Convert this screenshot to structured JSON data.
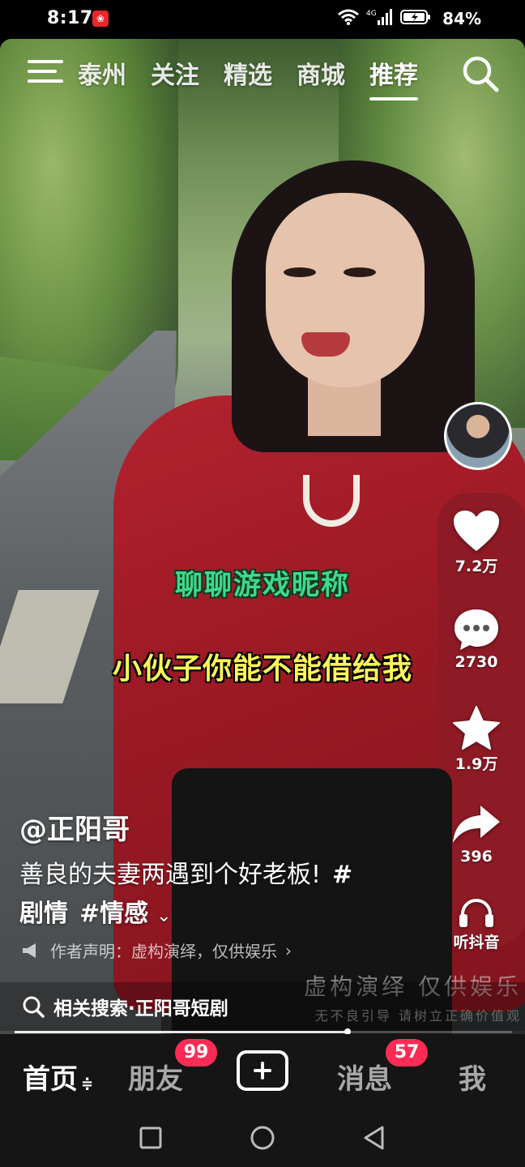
{
  "status_bar": {
    "time": "8:17",
    "network": "4G",
    "battery_pct": "84%"
  },
  "top_nav": {
    "tabs": [
      {
        "label": "泰州",
        "active": false
      },
      {
        "label": "关注",
        "active": false
      },
      {
        "label": "精选",
        "active": false
      },
      {
        "label": "商城",
        "active": false
      },
      {
        "label": "推荐",
        "active": true
      }
    ],
    "menu_icon": "hamburger-icon",
    "search_icon": "search-icon"
  },
  "video": {
    "subtitle_top": "聊聊游戏昵称",
    "subtitle_main": "小伙子你能不能借给我",
    "author": "@正阳哥",
    "description": "善良的夫妻两遇到个好老板!",
    "tags": [
      "#剧情",
      "#情感"
    ],
    "disclaimer": "作者声明：虚构演绎，仅供娱乐",
    "watermark_line1": "虚构演绎  仅供娱乐",
    "watermark_line2": "无不良引导  请树立正确价值观",
    "progress": 0.67
  },
  "actions": {
    "likes": "7.2万",
    "comments": "2730",
    "favorites": "1.9万",
    "shares": "396",
    "listen_label": "听抖音"
  },
  "related_search": {
    "label": "相关搜索·正阳哥短剧"
  },
  "tab_bar": {
    "home": "首页",
    "home_swap": "≑",
    "friends": "朋友",
    "friends_badge": "99",
    "messages": "消息",
    "messages_badge": "57",
    "me": "我"
  },
  "colors": {
    "badge": "#fe2c55",
    "subtitle_green": "#3fd88c",
    "subtitle_yellow": "#fff65a",
    "tab_bar_bg": "#151515"
  }
}
